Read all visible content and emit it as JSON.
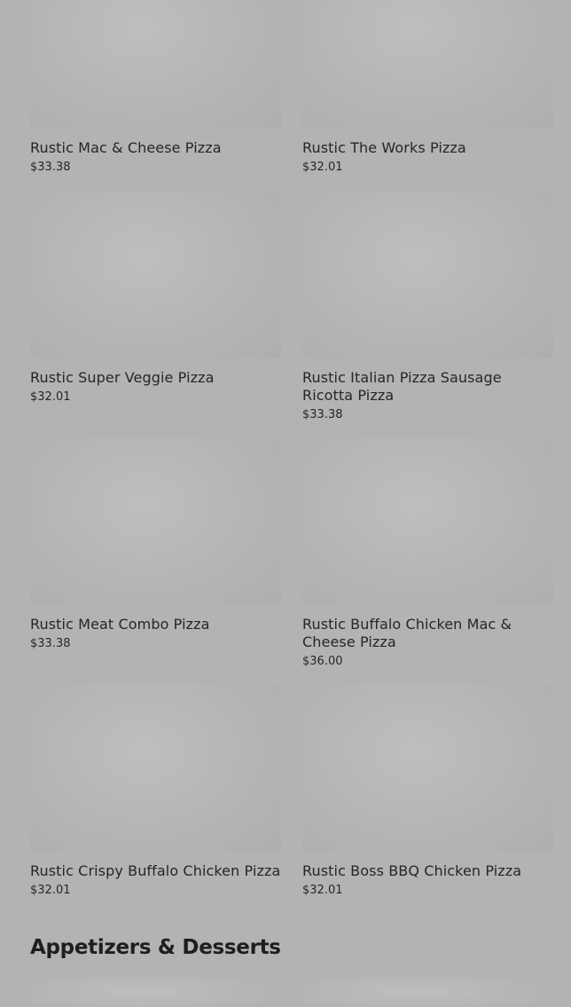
{
  "pizzas": [
    {
      "name": "Rustic Mac & Cheese Pizza",
      "price": "$33.38"
    },
    {
      "name": "Rustic The Works Pizza",
      "price": "$32.01"
    },
    {
      "name": "Rustic Super Veggie Pizza",
      "price": "$32.01"
    },
    {
      "name": "Rustic Italian Pizza  Sausage Ricotta Pizza",
      "price": "$33.38"
    },
    {
      "name": "Rustic Meat Combo Pizza",
      "price": "$33.38"
    },
    {
      "name": "Rustic Buffalo Chicken Mac & Cheese Pizza",
      "price": "$36.00"
    },
    {
      "name": "Rustic Crispy Buffalo Chicken Pizza",
      "price": "$32.01"
    },
    {
      "name": "Rustic Boss BBQ Chicken Pizza",
      "price": "$32.01"
    }
  ],
  "appetizers": {
    "title": "Appetizers & Desserts"
  }
}
